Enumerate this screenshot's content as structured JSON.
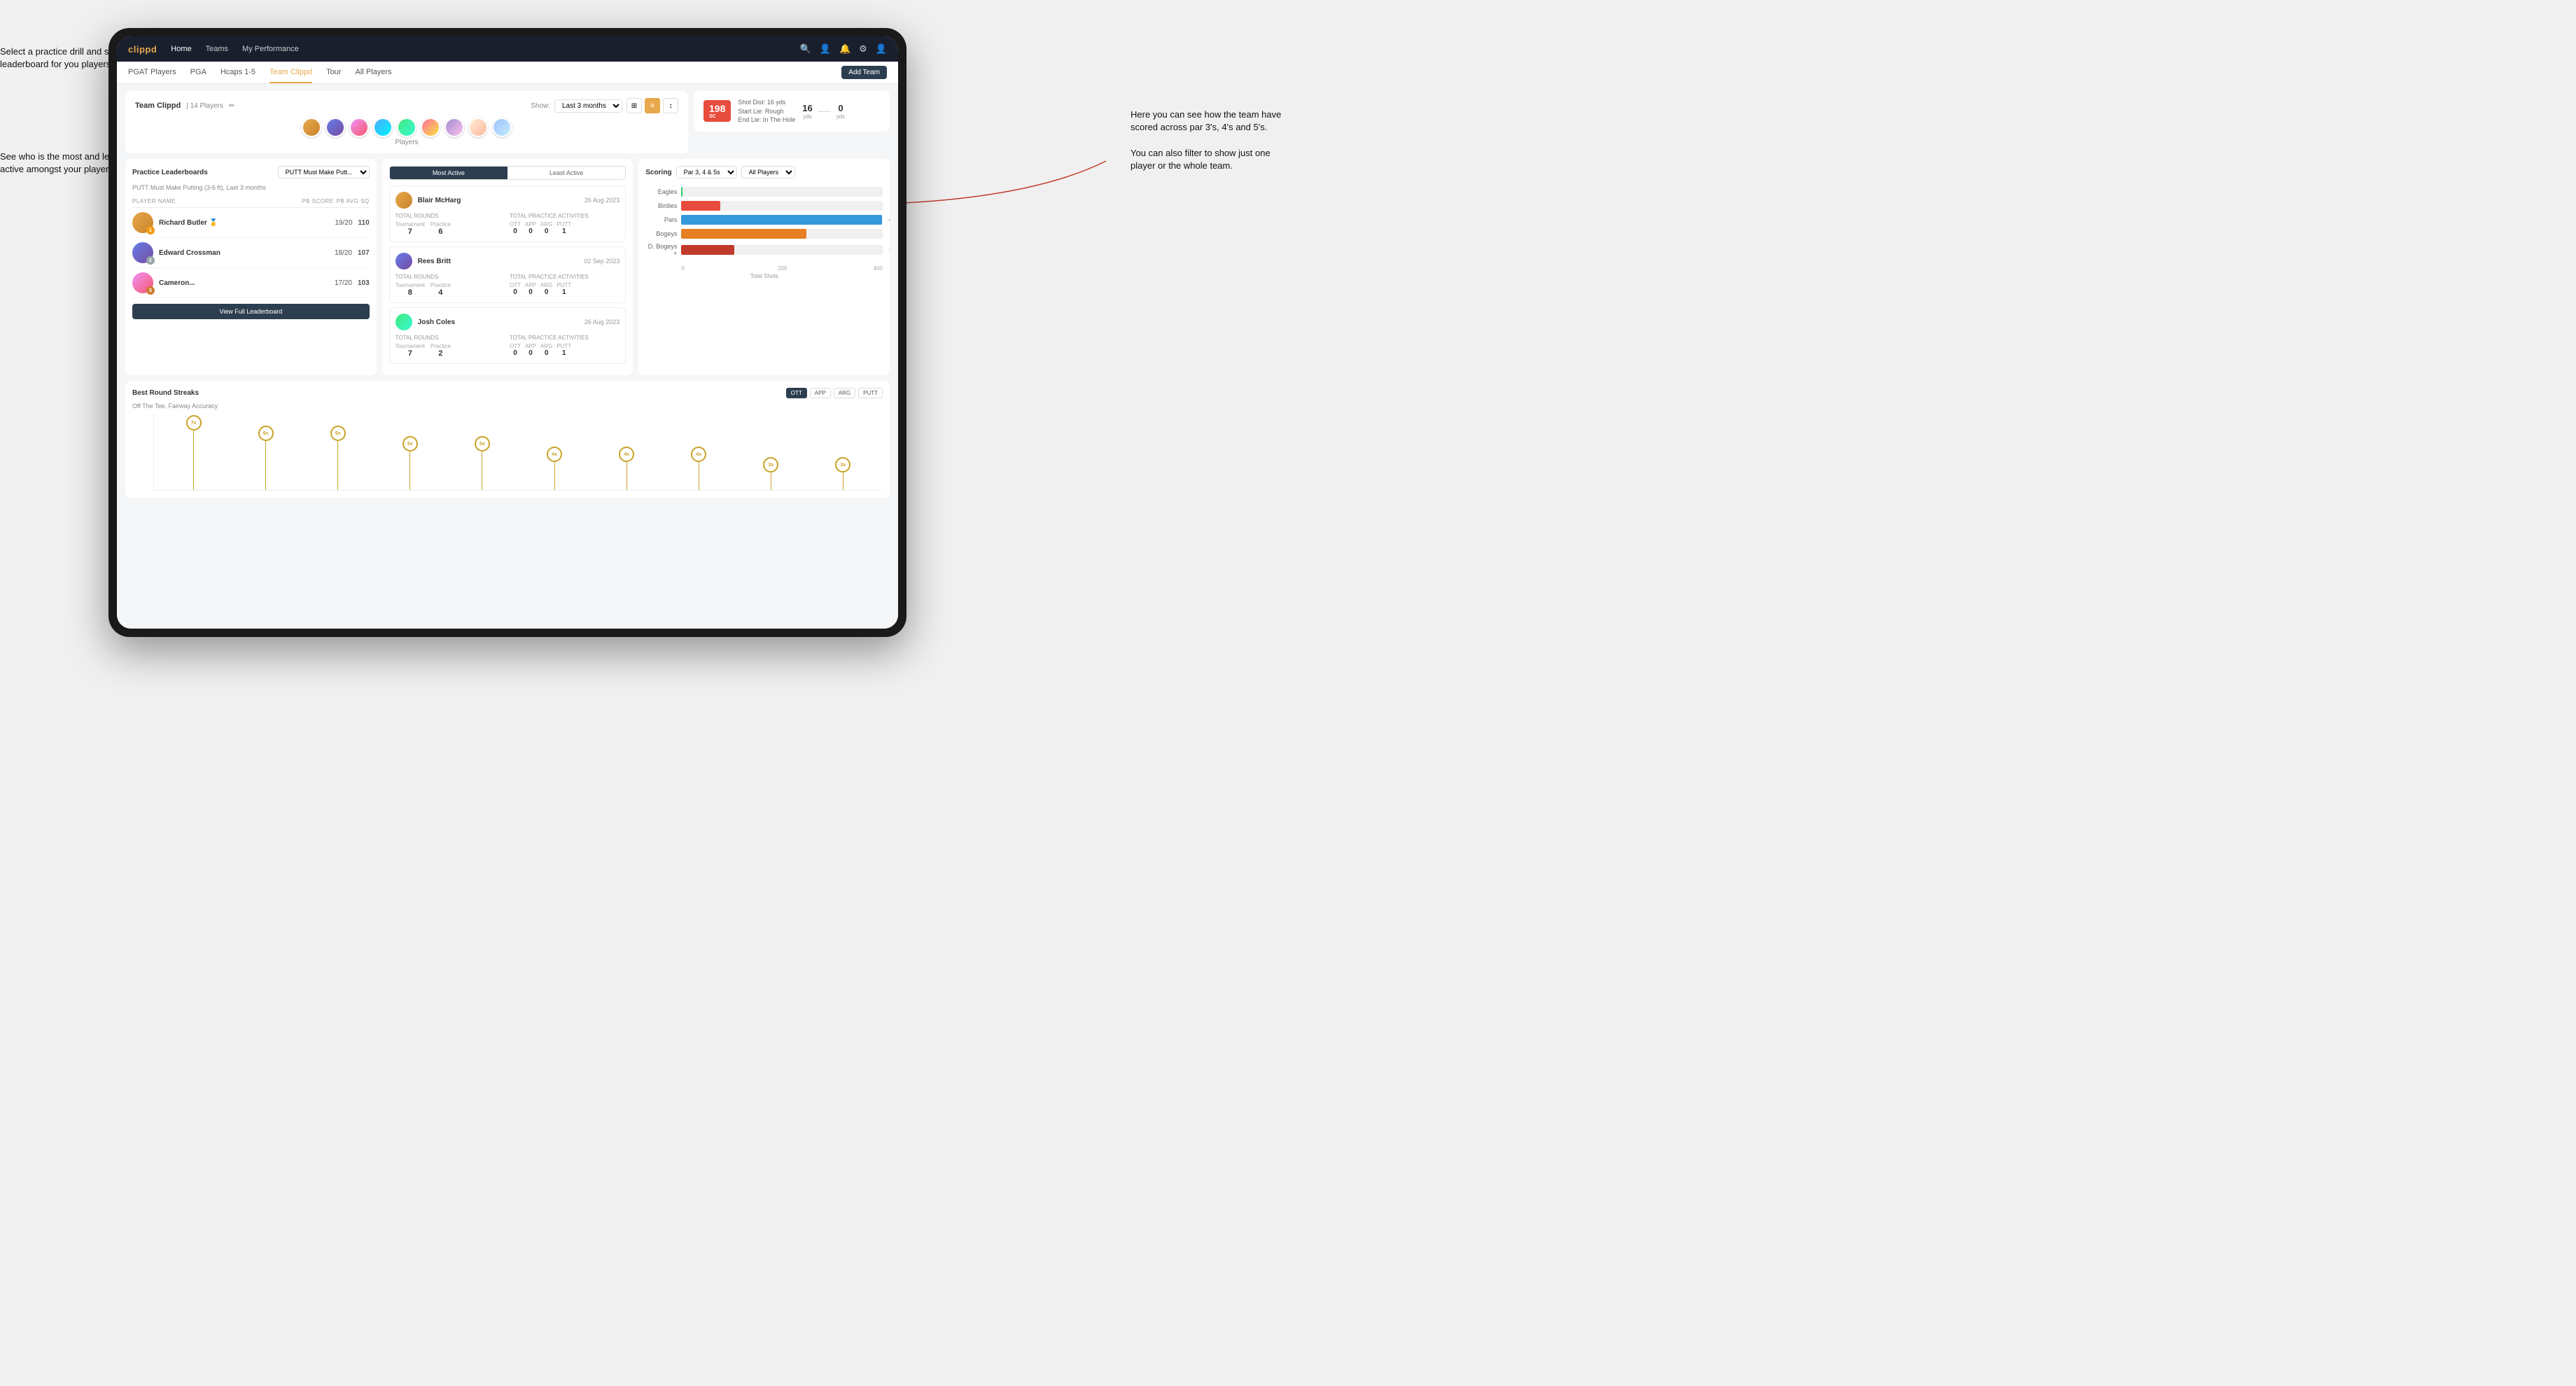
{
  "annotations": {
    "left1": "Select a practice drill and see the leaderboard for you players.",
    "left2": "See who is the most and least active amongst your players.",
    "right1": "Here you can see how the team have scored across par 3's, 4's and 5's.\n\nYou can also filter to show just one player or the whole team."
  },
  "navbar": {
    "logo": "clippd",
    "links": [
      "Home",
      "Teams",
      "My Performance"
    ],
    "icons": [
      "search",
      "person",
      "bell",
      "settings",
      "avatar"
    ]
  },
  "subnav": {
    "links": [
      "PGAT Players",
      "PGA",
      "Hcaps 1-5",
      "Team Clippd",
      "Tour",
      "All Players"
    ],
    "active": "Team Clippd",
    "add_team": "Add Team"
  },
  "team": {
    "name": "Team Clippd",
    "player_count": "14 Players",
    "show_label": "Show:",
    "show_period": "Last 3 months",
    "players_label": "Players"
  },
  "shot_card": {
    "badge": "198",
    "badge_sub": "SC",
    "info_line1": "Shot Dist: 16 yds",
    "info_line2": "Start Lie: Rough",
    "info_line3": "End Lie: In The Hole",
    "yds1": "16",
    "yds1_label": "yds",
    "yds2": "0",
    "yds2_label": "yds"
  },
  "leaderboard": {
    "title": "Practice Leaderboards",
    "drill": "PUTT Must Make Putt...",
    "subtitle": "PUTT Must Make Putting (3-6 ft), Last 3 months",
    "columns": [
      "PLAYER NAME",
      "PB SCORE",
      "PB AVG SQ"
    ],
    "players": [
      {
        "name": "Richard Butler",
        "score": "19/20",
        "avg": "110",
        "badge": "gold",
        "rank": 1
      },
      {
        "name": "Edward Crossman",
        "score": "18/20",
        "avg": "107",
        "badge": "silver",
        "rank": 2
      },
      {
        "name": "Cameron...",
        "score": "17/20",
        "avg": "103",
        "badge": "bronze",
        "rank": 3
      }
    ],
    "view_full": "View Full Leaderboard"
  },
  "active_panel": {
    "tabs": [
      "Most Active",
      "Least Active"
    ],
    "active_tab": "Most Active",
    "players": [
      {
        "name": "Blair McHarg",
        "date": "26 Aug 2023",
        "total_rounds_label": "Total Rounds",
        "tournament": "7",
        "practice": "6",
        "practice_activities_label": "Total Practice Activities",
        "ott": "0",
        "app": "0",
        "arg": "0",
        "putt": "1"
      },
      {
        "name": "Rees Britt",
        "date": "02 Sep 2023",
        "total_rounds_label": "Total Rounds",
        "tournament": "8",
        "practice": "4",
        "practice_activities_label": "Total Practice Activities",
        "ott": "0",
        "app": "0",
        "arg": "0",
        "putt": "1"
      },
      {
        "name": "Josh Coles",
        "date": "26 Aug 2023",
        "total_rounds_label": "Total Rounds",
        "tournament": "7",
        "practice": "2",
        "practice_activities_label": "Total Practice Activities",
        "ott": "0",
        "app": "0",
        "arg": "0",
        "putt": "1"
      }
    ]
  },
  "scoring": {
    "title": "Scoring",
    "par_filter": "Par 3, 4 & 5s",
    "player_filter": "All Players",
    "bars": [
      {
        "label": "Eagles",
        "value": 3,
        "max": 500,
        "color": "#2ecc71"
      },
      {
        "label": "Birdies",
        "value": 96,
        "max": 500,
        "color": "#e74c3c"
      },
      {
        "label": "Pars",
        "value": 499,
        "max": 500,
        "color": "#3498db"
      },
      {
        "label": "Bogeys",
        "value": 311,
        "max": 500,
        "color": "#e67e22"
      },
      {
        "label": "D. Bogeys +",
        "value": 131,
        "max": 500,
        "color": "#c0392b"
      }
    ],
    "x_axis": [
      "0",
      "200",
      "400"
    ],
    "x_label": "Total Shots"
  },
  "streaks": {
    "title": "Best Round Streaks",
    "subtitle": "Off The Tee, Fairway Accuracy",
    "buttons": [
      "OTT",
      "APP",
      "ARG",
      "PUTT"
    ],
    "active_button": "OTT",
    "dots": [
      {
        "value": "7x",
        "height": 95
      },
      {
        "value": "6x",
        "height": 80
      },
      {
        "value": "6x",
        "height": 80
      },
      {
        "value": "5x",
        "height": 65
      },
      {
        "value": "5x",
        "height": 65
      },
      {
        "value": "4x",
        "height": 50
      },
      {
        "value": "4x",
        "height": 50
      },
      {
        "value": "4x",
        "height": 50
      },
      {
        "value": "3x",
        "height": 35
      },
      {
        "value": "3x",
        "height": 35
      }
    ]
  }
}
